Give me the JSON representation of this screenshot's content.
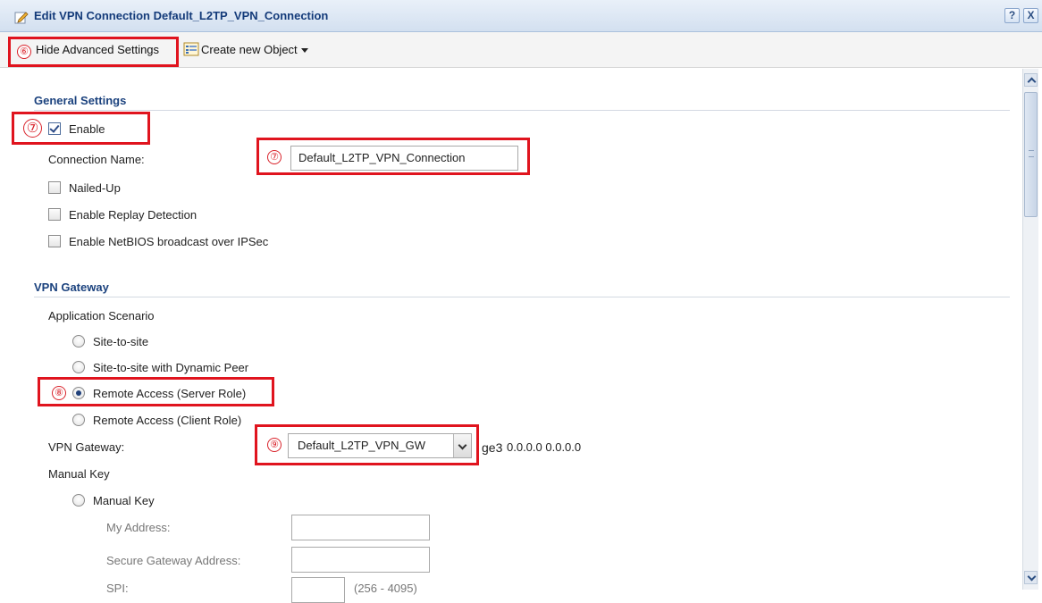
{
  "window": {
    "title": "Edit VPN Connection Default_L2TP_VPN_Connection",
    "help_label": "?",
    "close_label": "X"
  },
  "toolbar": {
    "hide_advanced_label": "Hide Advanced Settings",
    "create_object_label": "Create new Object"
  },
  "annotations": {
    "hide_advanced": "⑥",
    "enable": "⑦",
    "connection_name": "⑦",
    "remote_access": "⑧",
    "vpn_gateway": "⑨"
  },
  "general_settings": {
    "title": "General Settings",
    "enable_label": "Enable",
    "enable_checked": true,
    "connection_name_label": "Connection Name:",
    "connection_name_value": "Default_L2TP_VPN_Connection",
    "nailed_up_label": "Nailed-Up",
    "replay_detection_label": "Enable Replay Detection",
    "netbios_label": "Enable NetBIOS broadcast over IPSec"
  },
  "vpn_gateway": {
    "title": "VPN Gateway",
    "scenario_label": "Application Scenario",
    "site_to_site_label": "Site-to-site",
    "site_dynamic_label": "Site-to-site with Dynamic Peer",
    "remote_server_label": "Remote Access (Server Role)",
    "remote_client_label": "Remote Access (Client Role)",
    "selected_scenario": "Remote Access (Server Role)",
    "gateway_label": "VPN Gateway:",
    "gateway_value": "Default_L2TP_VPN_GW",
    "gateway_info_iface": "ge3",
    "gateway_info_addr": "0.0.0.0 0.0.0.0",
    "manual_key_section_label": "Manual Key",
    "manual_key_radio_label": "Manual Key",
    "my_address_label": "My Address:",
    "secure_gateway_label": "Secure Gateway Address:",
    "spi_label": "SPI:",
    "spi_range": "(256 - 4095)"
  },
  "colors": {
    "section_title": "#1b427e",
    "annotation_red": "#e0141e",
    "title_text": "#143b7a"
  },
  "icons": {
    "title": "edit-pencil-icon",
    "create_object": "object-list-icon"
  }
}
